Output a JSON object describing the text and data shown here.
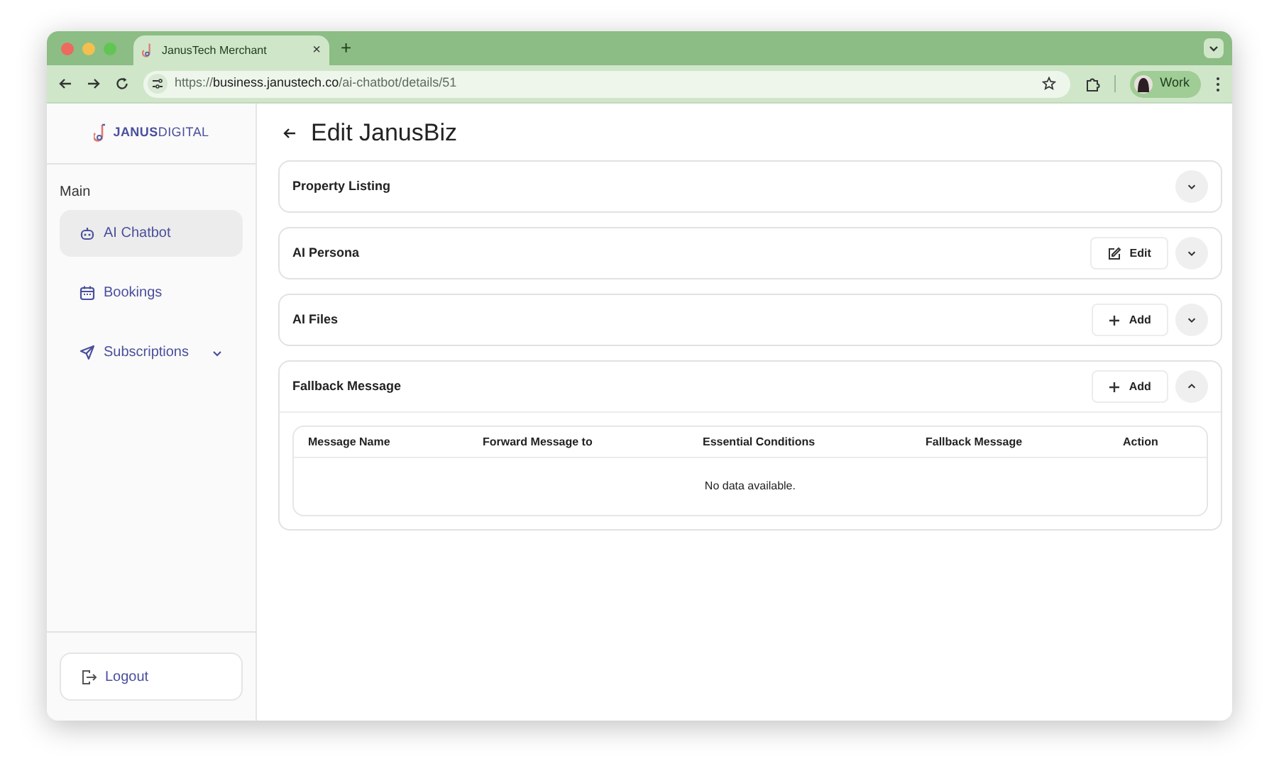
{
  "browser": {
    "tab": {
      "title": "JanusTech Merchant",
      "close": "×"
    },
    "new_tab": "+",
    "url": {
      "scheme": "https://",
      "host": "business.janustech.co",
      "path": "/ai-chatbot/details/51"
    },
    "profile": "Work"
  },
  "sidebar": {
    "logo": "**JANUS**DIGITAL",
    "section": "Main",
    "items": [
      {
        "label": "AI Chatbot",
        "selected": true,
        "expandable": false
      },
      {
        "label": "Bookings",
        "selected": false,
        "expandable": false
      },
      {
        "label": "Subscriptions",
        "selected": false,
        "expandable": true
      }
    ],
    "logout": "Logout"
  },
  "page": {
    "title": "Edit JanusBiz",
    "sections": [
      {
        "title": "Property Listing",
        "expanded": false
      },
      {
        "title": "AI Persona",
        "action": {
          "kind": "edit",
          "label": "Edit"
        },
        "expanded": false
      },
      {
        "title": "AI Files",
        "action": {
          "kind": "add",
          "label": "Add"
        },
        "expanded": false
      },
      {
        "title": "Fallback Message",
        "action": {
          "kind": "add",
          "label": "Add"
        },
        "expanded": true,
        "table": {
          "columns": [
            "Message Name",
            "Forward Message to",
            "Essential Conditions",
            "Fallback Message",
            "Action"
          ],
          "empty": "No data available."
        }
      }
    ]
  }
}
